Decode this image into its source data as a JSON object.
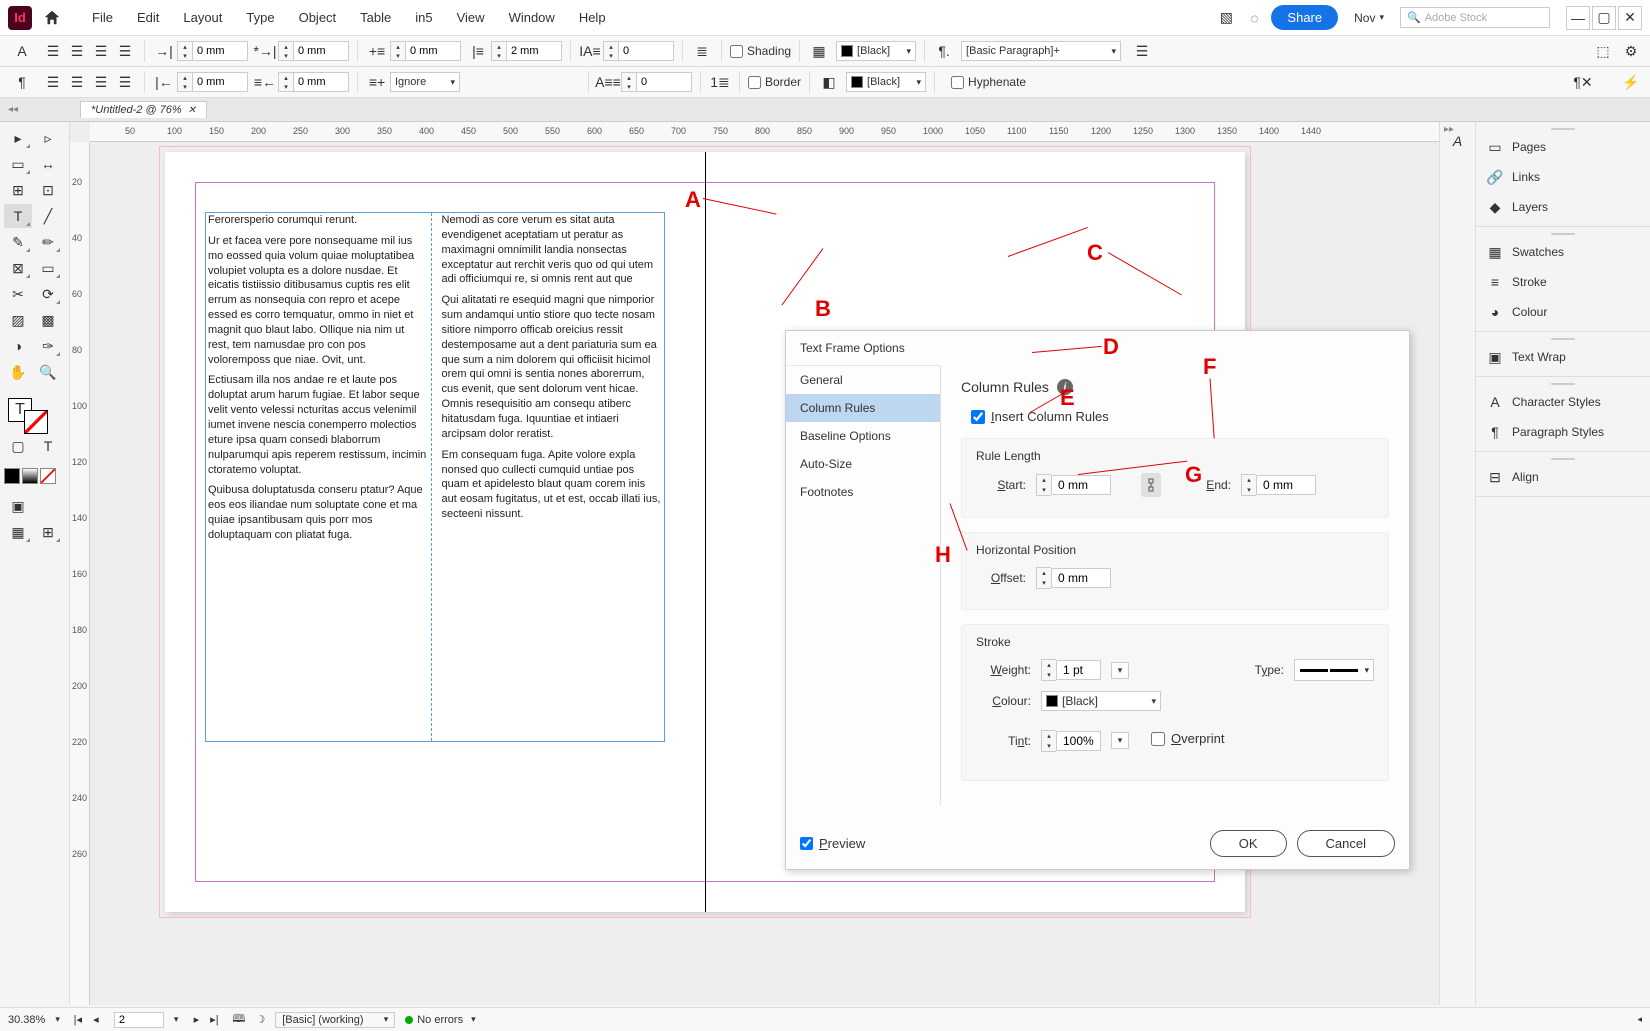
{
  "menu": {
    "items": [
      "File",
      "Edit",
      "Layout",
      "Type",
      "Object",
      "Table",
      "in5",
      "View",
      "Window",
      "Help"
    ]
  },
  "menubar_right": {
    "share": "Share",
    "nov": "Nov",
    "search_ph": "Adobe Stock"
  },
  "toolbar": {
    "row1": {
      "v0": "0 mm",
      "v1": "0 mm",
      "v2": "0 mm",
      "v3": "2 mm",
      "v4": "0",
      "shading": "Shading",
      "black": "[Black]",
      "para_style": "[Basic Paragraph]+"
    },
    "row2": {
      "v0": "0 mm",
      "v1": "0 mm",
      "ignore": "Ignore",
      "v4": "0",
      "border": "Border",
      "black2": "[Black]",
      "hyphenate": "Hyphenate"
    }
  },
  "tab": {
    "title": "*Untitled-2 @ 76%"
  },
  "ruler_h": [
    "50",
    "100",
    "150",
    "200",
    "250",
    "300",
    "350",
    "400",
    "450",
    "500",
    "550",
    "600",
    "650",
    "700",
    "750",
    "800",
    "850",
    "900",
    "950",
    "1000",
    "1050",
    "1100",
    "1150",
    "1200",
    "1250",
    "1300",
    "1350",
    "1400",
    "1440"
  ],
  "ruler_v": [
    "20",
    "40",
    "60",
    "80",
    "100",
    "120",
    "140",
    "160",
    "180",
    "200",
    "220",
    "240",
    "260"
  ],
  "text": {
    "col1": [
      "Ferorersperio corumqui rerunt.",
      "Ur et facea vere pore nonsequame mil ius mo eossed quia volum quiae moluptatibea volupiet volupta es a dolore nusdae. Et eicatis tistiissio ditibusamus cuptis res elit errum as nonsequia con repro et acepe essed es corro temquatur, ommo in niet et magnit quo blaut labo. Ollique nia nim ut rest, tem namusdae pro con pos voloremposs que niae. Ovit, unt.",
      "Ectiusam illa nos andae re et laute pos doluptat arum harum fugiae. Et labor seque velit vento velessi ncturitas accus velenimil iumet invene nescia conemperro molectios eture ipsa quam consedi blaborrum nulparumqui apis reperem restissum, incimin ctoratemo voluptat.",
      "Quibusa doluptatusda conseru ptatur? Aque eos eos iliandae num soluptate cone et ma quiae ipsantibusam quis porr mos doluptaquam con pliatat fuga."
    ],
    "col2": [
      "Nemodi as core verum es sitat auta evendigenet aceptatiam ut peratur as maximagni omnimilit landia nonsectas exceptatur aut rerchit veris quo od qui utem adi officiumqui re, si omnis rent aut que",
      "Qui alitatati re esequid magni que nimporior sum andamqui untio stiore quo tecte nosam sitiore nimporro officab oreicius ressit destemposame aut a dent pariaturia sum ea que sum a nim dolorem qui officiisit hicimol orem qui omni is sentia nones aborerrum, cus evenit, que sent dolorum vent hicae. Omnis resequisitio am consequ atiberc hitatusdam fuga. Iquuntiae et intiaeri arcipsam dolor reratist.",
      "Em consequam fuga. Apite volore expla nonsed quo cullecti cumquid untiae pos quam et apidelesto blaut quam corem inis aut eosam fugitatus, ut et est, occab illati ius, secteeni nissunt."
    ]
  },
  "dialog": {
    "title": "Text Frame Options",
    "sidebar": [
      "General",
      "Column Rules",
      "Baseline Options",
      "Auto-Size",
      "Footnotes"
    ],
    "content_title": "Column Rules",
    "insert_label": "Insert Column Rules",
    "rule_length": {
      "title": "Rule Length",
      "start_label": "Start:",
      "start_val": "0 mm",
      "end_label": "End:",
      "end_val": "0 mm"
    },
    "hpos": {
      "title": "Horizontal Position",
      "offset_label": "Offset:",
      "offset_val": "0 mm"
    },
    "stroke": {
      "title": "Stroke",
      "weight_label": "Weight:",
      "weight_val": "1 pt",
      "type_label": "Type:",
      "colour_label": "Colour:",
      "colour_val": "[Black]",
      "tint_label": "Tint:",
      "tint_val": "100%",
      "overprint": "Overprint"
    },
    "preview": "Preview",
    "ok": "OK",
    "cancel": "Cancel"
  },
  "right_panels": [
    {
      "grip": true,
      "items": [
        {
          "ico": "▭",
          "label": "Pages"
        },
        {
          "ico": "🔗",
          "label": "Links"
        },
        {
          "ico": "◆",
          "label": "Layers"
        }
      ]
    },
    {
      "grip": true,
      "items": [
        {
          "ico": "▦",
          "label": "Swatches"
        },
        {
          "ico": "≡",
          "label": "Stroke"
        },
        {
          "ico": "◕",
          "label": "Colour"
        }
      ]
    },
    {
      "grip": true,
      "items": [
        {
          "ico": "▣",
          "label": "Text Wrap"
        }
      ]
    },
    {
      "grip": true,
      "items": [
        {
          "ico": "A",
          "label": "Character Styles"
        },
        {
          "ico": "¶",
          "label": "Paragraph Styles"
        }
      ]
    },
    {
      "grip": true,
      "items": [
        {
          "ico": "⊟",
          "label": "Align"
        }
      ]
    }
  ],
  "status": {
    "zoom": "30.38%",
    "page": "2",
    "style": "[Basic] (working)",
    "errors": "No errors"
  },
  "annotations": {
    "A": "A",
    "B": "B",
    "C": "C",
    "D": "D",
    "E": "E",
    "F": "F",
    "G": "G",
    "H": "H"
  }
}
